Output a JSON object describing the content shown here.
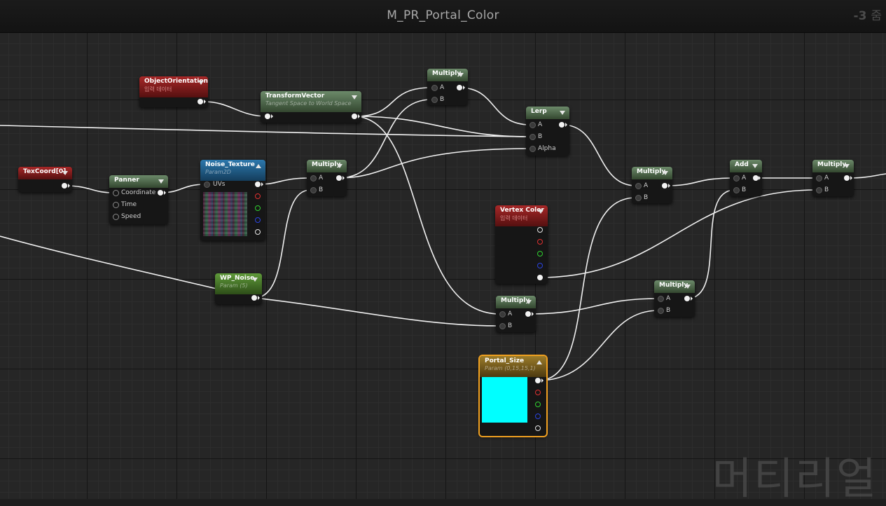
{
  "graph": {
    "title": "M_PR_Portal_Color",
    "zoom": "-3",
    "zoom_suffix": "줌",
    "watermark": "머티리얼"
  },
  "nodes": {
    "object_orientation": {
      "title": "ObjectOrientation",
      "subtitle": "입력 데이터"
    },
    "transform_vector": {
      "title": "TransformVector",
      "subtitle": "Tangent Space to World Space"
    },
    "multiply_top": {
      "title": "Multiply",
      "pin_a": "A",
      "pin_b": "B"
    },
    "lerp": {
      "title": "Lerp",
      "pin_a": "A",
      "pin_b": "B",
      "pin_alpha": "Alpha"
    },
    "texcoord": {
      "title": "TexCoord[0]"
    },
    "panner": {
      "title": "Panner",
      "pin_coordinate": "Coordinate",
      "pin_time": "Time",
      "pin_speed": "Speed"
    },
    "noise_texture": {
      "title": "Noise_Texture",
      "subtitle": "Param2D",
      "pin_uvs": "UVs"
    },
    "multiply_noise": {
      "title": "Multiply",
      "pin_a": "A",
      "pin_b": "B"
    },
    "multiply_mid": {
      "title": "Multiply",
      "pin_a": "A",
      "pin_b": "B"
    },
    "add": {
      "title": "Add",
      "pin_a": "A",
      "pin_b": "B"
    },
    "multiply_right": {
      "title": "Multiply",
      "pin_a": "A",
      "pin_b": "B"
    },
    "vertex_color": {
      "title": "Vertex Color",
      "subtitle": "입력 데이터"
    },
    "wp_noise": {
      "title": "WP_Noise",
      "subtitle": "Param (5)"
    },
    "multiply_low": {
      "title": "Multiply",
      "pin_a": "A",
      "pin_b": "B"
    },
    "multiply_lowright": {
      "title": "Multiply",
      "pin_a": "A",
      "pin_b": "B"
    },
    "portal_size": {
      "title": "Portal_Size",
      "subtitle": "Param (0,15,15,1)",
      "swatch_color": "#00ffff"
    }
  },
  "colors": {
    "canvas": "#262626",
    "wire": "#ffffff",
    "selection": "#f0a020",
    "math_header": "#4a6548",
    "input_header": "#8a1e1e",
    "texture_header": "#1f5a85",
    "param_header": "#4a7a2a",
    "vector_param_header": "#7a6020"
  }
}
